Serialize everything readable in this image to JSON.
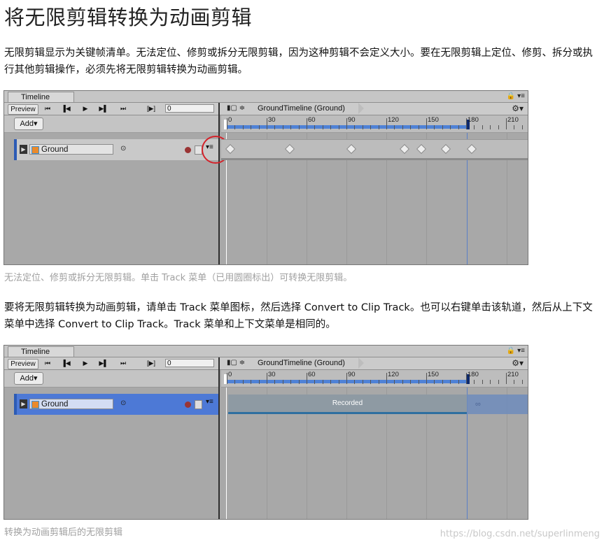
{
  "page": {
    "title": "将无限剪辑转换为动画剪辑",
    "para1": "无限剪辑显示为关键帧清单。无法定位、修剪或拆分无限剪辑，因为这种剪辑不会定义大小。要在无限剪辑上定位、修剪、拆分或执行其他剪辑操作，必须先将无限剪辑转换为动画剪辑。",
    "caption1": "无法定位、修剪或拆分无限剪辑。单击 Track 菜单（已用圆圈标出）可转换无限剪辑。",
    "para2": "要将无限剪辑转换为动画剪辑，请单击 Track 菜单图标，然后选择 Convert to Clip Track。也可以右键单击该轨道，然后从上下文菜单中选择 Convert to Clip Track。Track 菜单和上下文菜单是相同的。",
    "caption2": "转换为动画剪辑后的无限剪辑",
    "watermark": "https://blog.csdn.net/superlinmeng"
  },
  "timeline": {
    "tab_label": "Timeline",
    "preview_label": "Preview",
    "frame_value": "0",
    "breadcrumb": "GroundTimeline (Ground)",
    "add_label": "Add▾",
    "ruler_labels": [
      "0",
      "30",
      "60",
      "90",
      "120",
      "150",
      "180",
      "210"
    ],
    "track_name": "Ground",
    "clip_label": "Recorded",
    "tail_symbol": "∞",
    "icons": {
      "goto_start": "⏮",
      "prev_frame": "◀",
      "play": "▶",
      "next_frame": "▶▶",
      "goto_end": "⏭",
      "range": "[▶]",
      "lock": "🔒",
      "gear": "⚙",
      "menu": "▾≡",
      "target": "⊙"
    }
  }
}
